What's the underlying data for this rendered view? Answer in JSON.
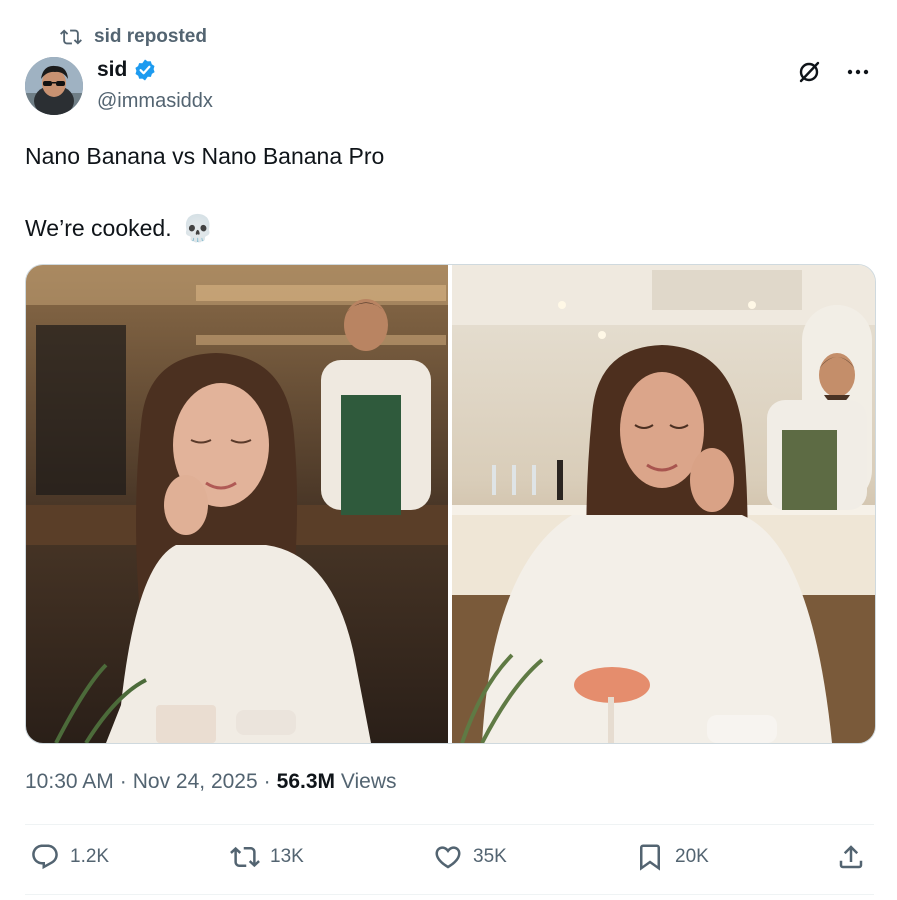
{
  "repost": {
    "label": "sid reposted"
  },
  "author": {
    "name": "sid",
    "handle": "@immasiddx",
    "verified": true
  },
  "post": {
    "line1": "Nano Banana vs Nano Banana Pro",
    "line2": "We’re cooked.",
    "emoji": "💀"
  },
  "meta": {
    "time": "10:30 AM",
    "sep1": "·",
    "date": "Nov 24, 2025",
    "sep2": "·",
    "views_count": "56.3M",
    "views_label": "Views"
  },
  "actions": {
    "replies": "1.2K",
    "reposts": "13K",
    "likes": "35K",
    "bookmarks": "20K"
  },
  "colors": {
    "accent": "#1d9bf0",
    "muted": "#536471",
    "text": "#0f1419"
  },
  "icons": [
    "repost-icon",
    "verified-badge-icon",
    "grok-icon",
    "more-icon",
    "reply-icon",
    "like-icon",
    "bookmark-icon",
    "share-icon"
  ]
}
